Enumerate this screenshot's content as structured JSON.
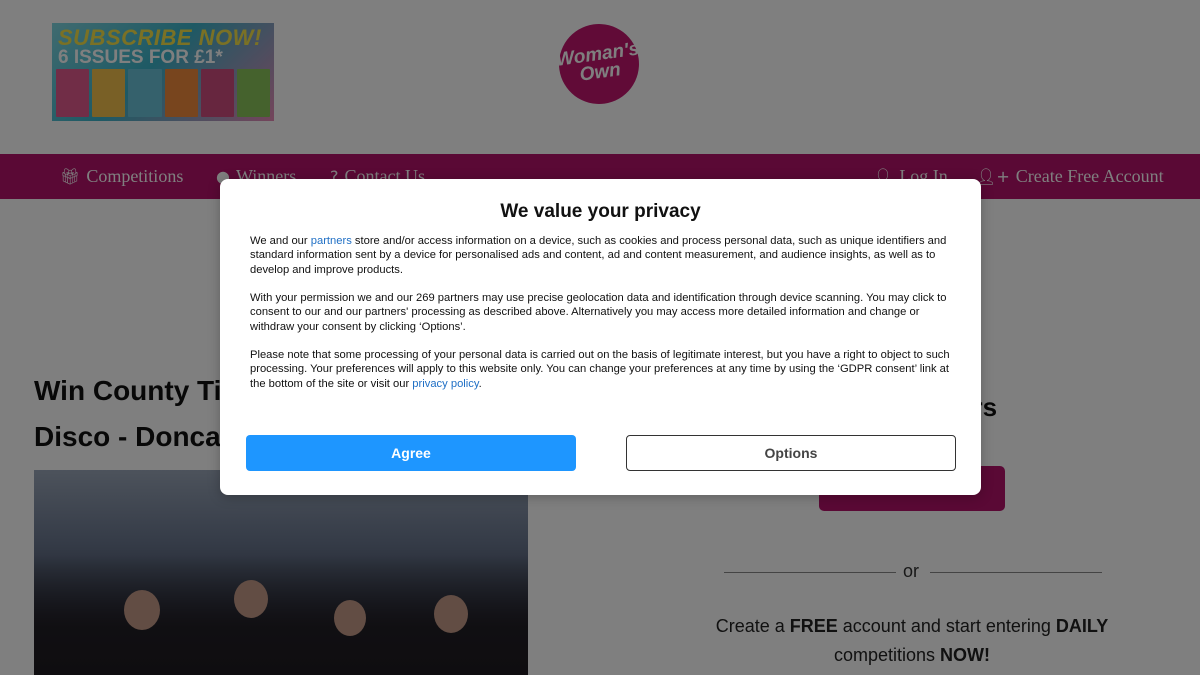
{
  "promo": {
    "line1": "SUBSCRIBE NOW!",
    "line2": "6 ISSUES FOR £1*",
    "cover_colors": [
      "#e25a8f",
      "#f3c04c",
      "#6bc3d8",
      "#f08a3c",
      "#cf4d7e",
      "#8ac45a"
    ]
  },
  "logo": {
    "line1": "Woman's",
    "line2": "Own"
  },
  "nav": {
    "competitions": "Competitions",
    "winners": "Winners",
    "contact": "Contact Us",
    "login": "Log In",
    "create_account": "Create Free Account"
  },
  "content": {
    "title_line1": "Win County Tic",
    "title_line2": "Disco - Doncas",
    "winners_heading": "ers",
    "or_text": "or",
    "cta": {
      "part1": "Create a ",
      "free": "FREE",
      "part2": " account and start entering ",
      "daily": "DAILY",
      "part3": " competitions ",
      "now": "NOW!"
    }
  },
  "modal": {
    "title": "We value your privacy",
    "p1_prefix": "We and our ",
    "p1_link": "partners",
    "p1_suffix": " store and/or access information on a device, such as cookies and process personal data, such as unique identifiers and standard information sent by a device for personalised ads and content, ad and content measurement, and audience insights, as well as to develop and improve products.",
    "p2": "With your permission we and our 269 partners may use precise geolocation data and identification through device scanning. You may click to consent to our and our partners' processing as described above. Alternatively you may access more detailed information and change or withdraw your consent by clicking ‘Options’.",
    "p3_prefix": "Please note that some processing of your personal data is carried out on the basis of legitimate interest, but you have a right to object to such processing. Your preferences will apply to this website only. You can change your preferences at any time by using the ‘GDPR consent’ link at the bottom of the site or visit our ",
    "p3_link": "privacy policy",
    "p3_suffix": ".",
    "agree": "Agree",
    "options": "Options"
  },
  "colors": {
    "brand": "#b5136a",
    "agree_button": "#1e96ff",
    "link": "#1f6fc5"
  },
  "icons": {
    "competitions": "gift-icon",
    "winners": "map-marker-icon",
    "contact": "question-circle-icon",
    "login": "user-icon",
    "create_account": "user-plus-icon"
  }
}
